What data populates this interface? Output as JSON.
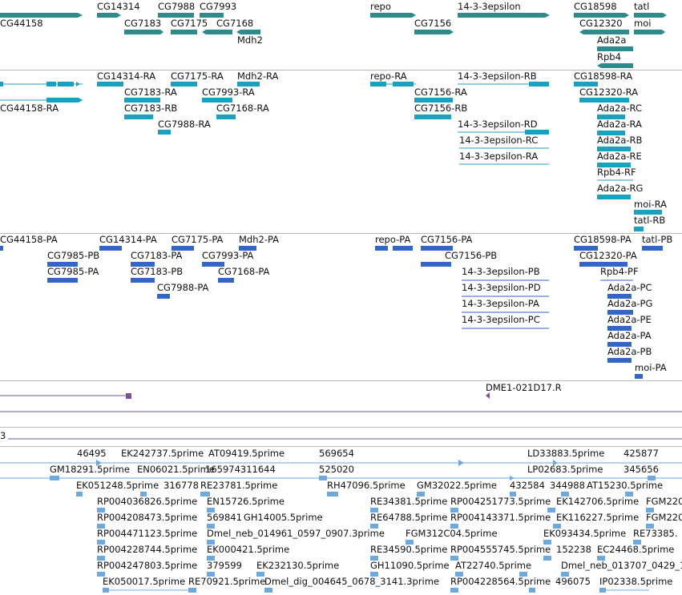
{
  "colors": {
    "gene": "#2e8b8b",
    "transcript": "#1aa0c0",
    "protein": "#3366cc",
    "clone": "#7a4f9e",
    "est": "#6fa8dc",
    "separator": "#b8b8b8"
  },
  "gene_track": {
    "labels": [
      "CG44158",
      "CG14314",
      "CG7988",
      "CG7993",
      "CG7183",
      "CG7175",
      "CG7168",
      "Mdh2",
      "repo",
      "14-3-3epsilon",
      "CG7156",
      "CG18598",
      "tatl",
      "CG12320",
      "moi",
      "Ada2a",
      "Rpb4"
    ]
  },
  "transcript_track": {
    "labels": [
      "CG44158-RA",
      "CG14314-RA",
      "CG7175-RA",
      "Mdh2-RA",
      "CG7183-RA",
      "CG7993-RA",
      "CG7183-RB",
      "CG7168-RA",
      "CG7988-RA",
      "repo-RA",
      "14-3-3epsilon-RB",
      "CG7156-RA",
      "CG7156-RB",
      "14-3-3epsilon-RD",
      "14-3-3epsilon-RC",
      "14-3-3epsilon-RA",
      "CG18598-RA",
      "CG12320-RA",
      "Ada2a-RC",
      "Ada2a-RA",
      "Ada2a-RB",
      "Ada2a-RE",
      "Rpb4-RF",
      "Ada2a-RG",
      "moi-RA",
      "tatl-RB"
    ]
  },
  "protein_track": {
    "labels": [
      "CG44158-PA",
      "CG14314-PA",
      "CG7175-PA",
      "Mdh2-PA",
      "CG7985-PB",
      "CG7183-PA",
      "CG7993-PA",
      "CG7985-PA",
      "CG7183-PB",
      "CG7168-PA",
      "CG7988-PA",
      "repo-PA",
      "CG7156-PA",
      "CG7156-PB",
      "14-3-3epsilon-PB",
      "14-3-3epsilon-PD",
      "14-3-3epsilon-PA",
      "14-3-3epsilon-PC",
      "CG18598-PA",
      "tatl-PB",
      "CG12320-PA",
      "Rpb4-PF",
      "Ada2a-PC",
      "Ada2a-PG",
      "Ada2a-PE",
      "Ada2a-PA",
      "Ada2a-PB",
      "moi-PA"
    ]
  },
  "clone_track": {
    "labels": [
      "DME1-021D17.R"
    ]
  },
  "small_track": {
    "labels": [
      "3"
    ]
  },
  "est_track": {
    "labels": [
      "46495",
      "EK242737.5prime",
      "AT09419.5prime",
      "569654",
      "LD33883.5prime",
      "425877",
      "GM18291.5prime",
      "EN06021.5prime",
      "165974311644",
      "525020",
      "LP02683.5prime",
      "345656",
      "EK051248.5prime",
      "316778",
      "RE23781.5prime",
      "RH47096.5prime",
      "GM32022.5prime",
      "432584",
      "344988",
      "AT15230.5prime",
      "RP004036826.5prime",
      "EN15726.5prime",
      "RE34381.5prime",
      "RP004251773.5prime",
      "EK142706.5prime",
      "FGM220",
      "RP004208473.5prime",
      "569841",
      "GH14005.5prime",
      "RE64788.5prime",
      "RP004143371.5prime",
      "EK116227.5prime",
      "FGM220",
      "RP004471123.5prime",
      "Dmel_neb_014961_0597_0907.3prime",
      "FGM312C04.5prime",
      "EK093434.5prime",
      "RE73385.",
      "RP004228744.5prime",
      "EK000421.5prime",
      "RE34590.5prime",
      "RP004555745.5prime",
      "152238",
      "EC24468.5prime",
      "RP004247803.5prime",
      "379599",
      "EK232130.5prime",
      "GH11090.5prime",
      "AT22740.5prime",
      "Dmel_neb_013707_0429_142",
      "EK050017.5prime",
      "RE70921.5prime",
      "Dmel_dig_004645_0678_3141.3prime",
      "RP004228564.5prime",
      "496075",
      "IP02338.5prime"
    ]
  }
}
